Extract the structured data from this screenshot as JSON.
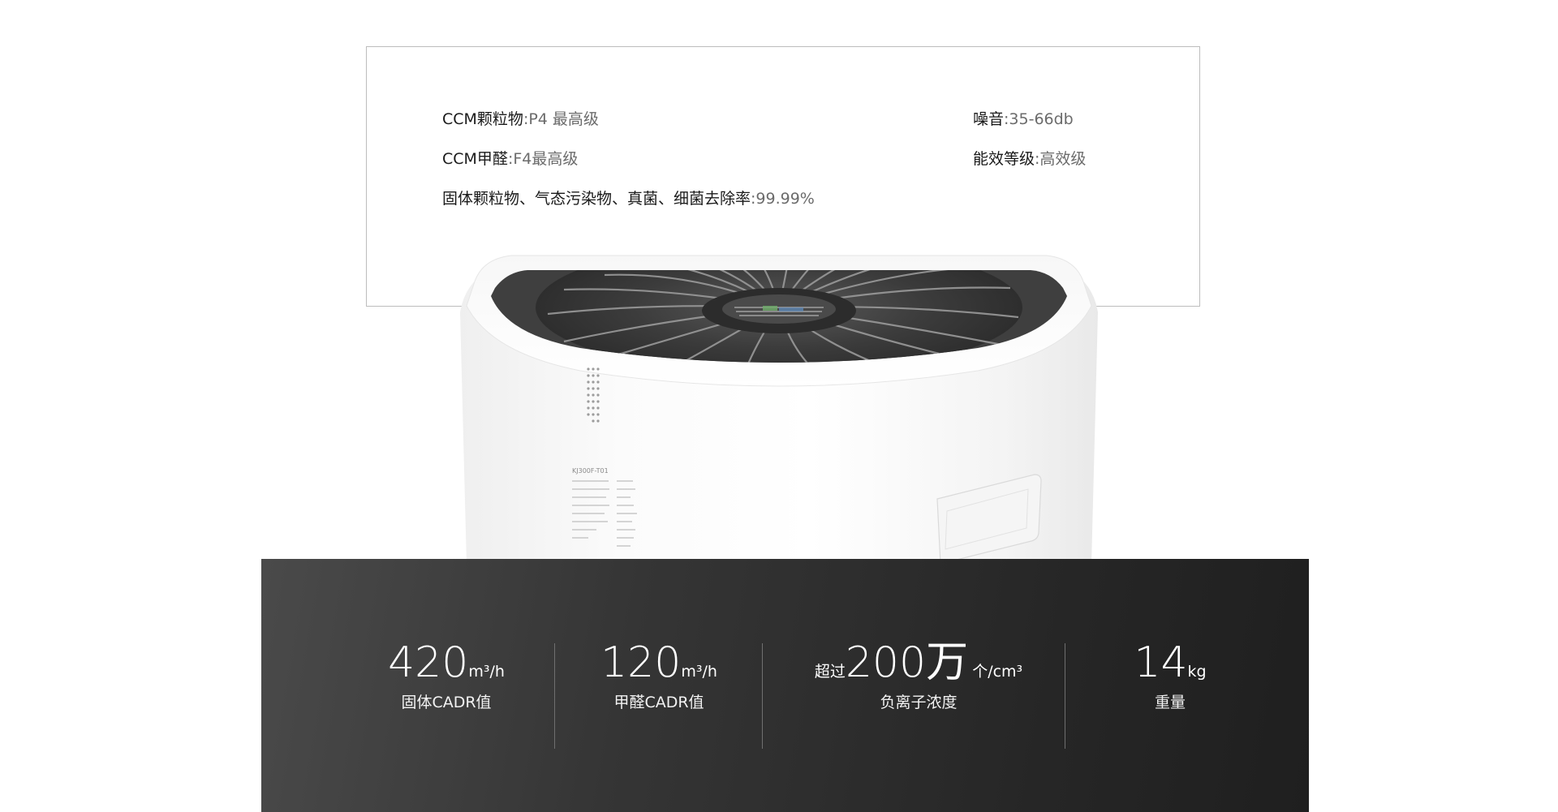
{
  "specs": {
    "left": [
      {
        "key": "CCM颗粒物",
        "value": ":P4 最高级"
      },
      {
        "key": "CCM甲醛",
        "value": ":F4最高级"
      },
      {
        "key": "固体颗粒物、气态污染物、真菌、细菌去除率",
        "value": ":99.99%"
      }
    ],
    "right": [
      {
        "key": "噪音",
        "value": ":35-66db"
      },
      {
        "key": "能效等级",
        "value": ":高效级"
      }
    ]
  },
  "product": {
    "label_model": "KJ300F-T01",
    "body_color": "#ffffff",
    "grille_color": "#3d3d3d"
  },
  "stats": [
    {
      "prefix": "",
      "value": "420",
      "unit": "m³/h",
      "label": "固体CADR值"
    },
    {
      "prefix": "",
      "value": "120",
      "unit": "m³/h",
      "label": "甲醛CADR值"
    },
    {
      "prefix": "超过",
      "value": "200万",
      "unit": "个/cm³",
      "label": "负离子浓度"
    },
    {
      "prefix": "",
      "value": "14",
      "unit": "kg",
      "label": "重量"
    }
  ],
  "colors": {
    "band_dark": "#262626",
    "band_light": "#4a4a4a",
    "spec_value": "#6b6b6b"
  }
}
